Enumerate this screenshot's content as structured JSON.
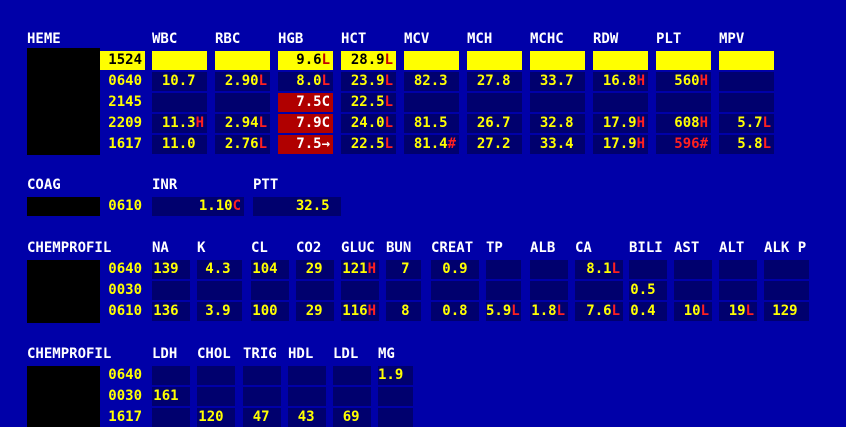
{
  "heme": {
    "title": "HEME",
    "columns": [
      "WBC",
      "RBC",
      "HGB",
      "HCT",
      "MCV",
      "MCH",
      "MCHC",
      "RDW",
      "PLT",
      "MPV"
    ],
    "rows": [
      {
        "time": "1524",
        "highlight": true,
        "cells": [
          {
            "v": "",
            "f": ""
          },
          {
            "v": "",
            "f": ""
          },
          {
            "v": "9.6",
            "f": "L"
          },
          {
            "v": "28.9",
            "f": "L"
          },
          {
            "v": "",
            "f": ""
          },
          {
            "v": "",
            "f": ""
          },
          {
            "v": "",
            "f": ""
          },
          {
            "v": "",
            "f": ""
          },
          {
            "v": "",
            "f": ""
          },
          {
            "v": "",
            "f": ""
          }
        ]
      },
      {
        "time": "0640",
        "cells": [
          {
            "v": "10.7",
            "f": ""
          },
          {
            "v": "2.90",
            "f": "L"
          },
          {
            "v": "8.0",
            "f": "L"
          },
          {
            "v": "23.9",
            "f": "L"
          },
          {
            "v": "82.3",
            "f": ""
          },
          {
            "v": "27.8",
            "f": ""
          },
          {
            "v": "33.7",
            "f": ""
          },
          {
            "v": "16.8",
            "f": "H"
          },
          {
            "v": "560",
            "f": "H"
          },
          {
            "v": "",
            "f": ""
          }
        ]
      },
      {
        "time": "2145",
        "cells": [
          {
            "v": "",
            "f": ""
          },
          {
            "v": "",
            "f": ""
          },
          {
            "v": "7.5",
            "f": "C",
            "red": true
          },
          {
            "v": "22.5",
            "f": "L"
          },
          {
            "v": "",
            "f": ""
          },
          {
            "v": "",
            "f": ""
          },
          {
            "v": "",
            "f": ""
          },
          {
            "v": "",
            "f": ""
          },
          {
            "v": "",
            "f": ""
          },
          {
            "v": "",
            "f": ""
          }
        ]
      },
      {
        "time": "2209",
        "cells": [
          {
            "v": "11.3",
            "f": "H"
          },
          {
            "v": "2.94",
            "f": "L"
          },
          {
            "v": "7.9",
            "f": "C",
            "red": true
          },
          {
            "v": "24.0",
            "f": "L"
          },
          {
            "v": "81.5",
            "f": ""
          },
          {
            "v": "26.7",
            "f": ""
          },
          {
            "v": "32.8",
            "f": ""
          },
          {
            "v": "17.9",
            "f": "H"
          },
          {
            "v": "608",
            "f": "H"
          },
          {
            "v": "5.7",
            "f": "L"
          }
        ]
      },
      {
        "time": "1617",
        "cells": [
          {
            "v": "11.0",
            "f": ""
          },
          {
            "v": "2.76",
            "f": "L"
          },
          {
            "v": "7.5",
            "f": "→",
            "red": true
          },
          {
            "v": "22.5",
            "f": "L"
          },
          {
            "v": "81.4",
            "f": "#"
          },
          {
            "v": "27.2",
            "f": ""
          },
          {
            "v": "33.4",
            "f": ""
          },
          {
            "v": "17.9",
            "f": "H"
          },
          {
            "v": "596",
            "f": "#",
            "redtext": true
          },
          {
            "v": "5.8",
            "f": "L"
          }
        ]
      }
    ]
  },
  "coag": {
    "title": "COAG",
    "columns": [
      "INR",
      "PTT"
    ],
    "rows": [
      {
        "time": "0610",
        "cells": [
          {
            "v": "1.10",
            "f": "C"
          },
          {
            "v": "32.5",
            "f": ""
          }
        ]
      }
    ]
  },
  "chem1": {
    "title": "CHEMPROFIL",
    "columns": [
      "NA",
      "K",
      "CL",
      "CO2",
      "GLUC",
      "BUN",
      "CREAT",
      "TP",
      "ALB",
      "CA",
      "BILI",
      "AST",
      "ALT",
      "ALK P"
    ],
    "rows": [
      {
        "time": "0640",
        "cells": [
          {
            "v": "139",
            "f": ""
          },
          {
            "v": "4.3",
            "f": ""
          },
          {
            "v": "104",
            "f": ""
          },
          {
            "v": "29",
            "f": ""
          },
          {
            "v": "121",
            "f": "H"
          },
          {
            "v": "7",
            "f": ""
          },
          {
            "v": "0.9",
            "f": ""
          },
          {
            "v": "",
            "f": ""
          },
          {
            "v": "",
            "f": ""
          },
          {
            "v": "8.1",
            "f": "L"
          },
          {
            "v": "",
            "f": ""
          },
          {
            "v": "",
            "f": ""
          },
          {
            "v": "",
            "f": ""
          },
          {
            "v": "",
            "f": ""
          }
        ]
      },
      {
        "time": "0030",
        "cells": [
          {
            "v": "",
            "f": ""
          },
          {
            "v": "",
            "f": ""
          },
          {
            "v": "",
            "f": ""
          },
          {
            "v": "",
            "f": ""
          },
          {
            "v": "",
            "f": ""
          },
          {
            "v": "",
            "f": ""
          },
          {
            "v": "",
            "f": ""
          },
          {
            "v": "",
            "f": ""
          },
          {
            "v": "",
            "f": ""
          },
          {
            "v": "",
            "f": ""
          },
          {
            "v": "0.5",
            "f": ""
          },
          {
            "v": "",
            "f": ""
          },
          {
            "v": "",
            "f": ""
          },
          {
            "v": "",
            "f": ""
          }
        ]
      },
      {
        "time": "0610",
        "cells": [
          {
            "v": "136",
            "f": ""
          },
          {
            "v": "3.9",
            "f": ""
          },
          {
            "v": "100",
            "f": ""
          },
          {
            "v": "29",
            "f": ""
          },
          {
            "v": "116",
            "f": "H"
          },
          {
            "v": "8",
            "f": ""
          },
          {
            "v": "0.8",
            "f": ""
          },
          {
            "v": "5.9",
            "f": "L"
          },
          {
            "v": "1.8",
            "f": "L"
          },
          {
            "v": "7.6",
            "f": "L"
          },
          {
            "v": "0.4",
            "f": ""
          },
          {
            "v": "10",
            "f": "L"
          },
          {
            "v": "19",
            "f": "L"
          },
          {
            "v": "129",
            "f": ""
          }
        ]
      }
    ]
  },
  "chem2": {
    "title": "CHEMPROFIL",
    "columns": [
      "LDH",
      "CHOL",
      "TRIG",
      "HDL",
      "LDL",
      "MG"
    ],
    "rows": [
      {
        "time": "0640",
        "cells": [
          {
            "v": "",
            "f": ""
          },
          {
            "v": "",
            "f": ""
          },
          {
            "v": "",
            "f": ""
          },
          {
            "v": "",
            "f": ""
          },
          {
            "v": "",
            "f": ""
          },
          {
            "v": "1.9",
            "f": ""
          }
        ]
      },
      {
        "time": "0030",
        "cells": [
          {
            "v": "161",
            "f": ""
          },
          {
            "v": "",
            "f": ""
          },
          {
            "v": "",
            "f": ""
          },
          {
            "v": "",
            "f": ""
          },
          {
            "v": "",
            "f": ""
          },
          {
            "v": "",
            "f": ""
          }
        ]
      },
      {
        "time": "1617",
        "cells": [
          {
            "v": "",
            "f": ""
          },
          {
            "v": "120",
            "f": ""
          },
          {
            "v": "47",
            "f": ""
          },
          {
            "v": "43",
            "f": ""
          },
          {
            "v": "69",
            "f": ""
          },
          {
            "v": "",
            "f": ""
          }
        ]
      }
    ]
  },
  "colors": {
    "background": "#0000a8",
    "cell": "#00006e",
    "value": "#ffff00",
    "flag": "#ff2020",
    "critical": "#b00000",
    "selected_row": "#ffff00"
  }
}
